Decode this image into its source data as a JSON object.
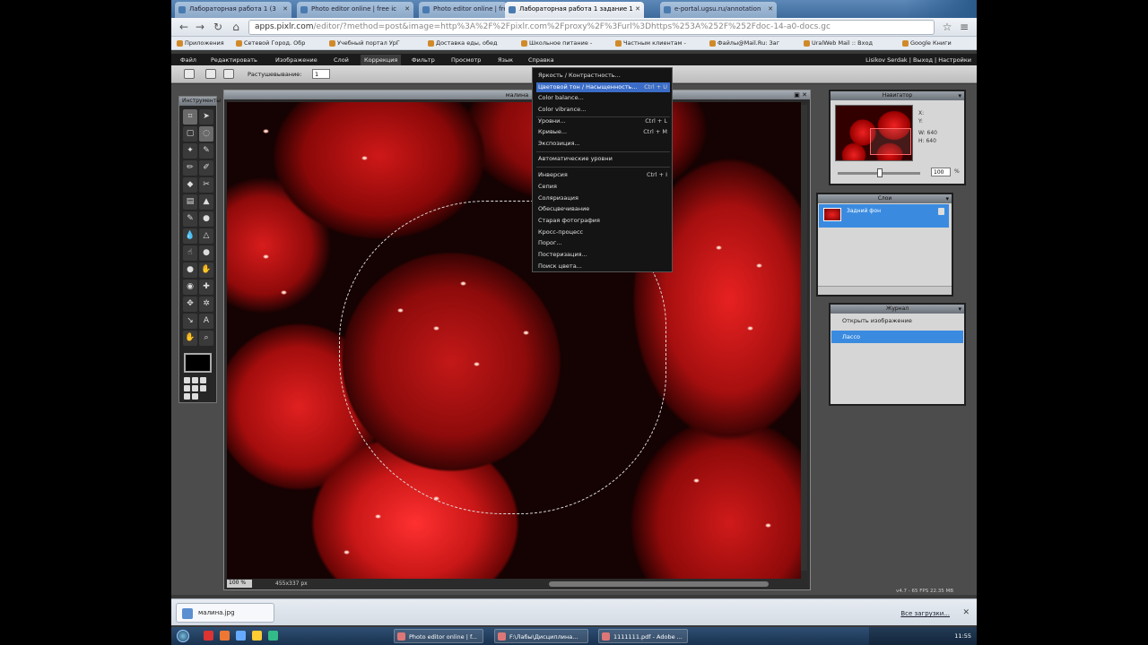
{
  "browser": {
    "tabs": [
      {
        "label": "Лабораторная работа 1 (3"
      },
      {
        "label": "Photo editor online | free ic"
      },
      {
        "label": "Photo editor online | free ic"
      },
      {
        "label": "Лабораторная работа 1 задание 1"
      },
      {
        "label": "e-portal.ugsu.ru/annotation"
      }
    ],
    "url_host": "apps.pixlr.com",
    "url_rest": "/editor/?method=post&image=http%3A%2F%2Fpixlr.com%2Fproxy%2F%3Furl%3Dhttps%253A%252F%252Fdoc-14-a0-docs.gc",
    "bookmarks": [
      "Приложения",
      "Сетевой Город. Обр",
      "Учебный портал УрГ",
      "Доставка еды, обед",
      "Школьное питание -",
      "Частным клиентам -",
      "Файлы@Mail.Ru: Заг",
      "UralWeb Mail :: Вход",
      "Google Книги"
    ]
  },
  "pixlr": {
    "menu": [
      "Файл",
      "Редактировать",
      "Изображение",
      "Слой",
      "Коррекция",
      "Фильтр",
      "Просмотр",
      "Язык",
      "Справка"
    ],
    "open_menu": "Коррекция",
    "user": "Lisikov Serdak",
    "logout": "Выход",
    "settings": "Настройки",
    "feather_label": "Растушевывание:",
    "feather_value": "1",
    "tools_title": "Инструменты",
    "doc_title": "малина",
    "zoom_value": "100",
    "zoom_unit": "%",
    "doc_size": "455x337 px",
    "adjust_menu": [
      {
        "label": "Яркость / Контрастность...",
        "shortcut": ""
      },
      {
        "label": "Цветовой тон / Насыщенность...",
        "shortcut": "Ctrl + U"
      },
      {
        "label": "Color balance...",
        "shortcut": ""
      },
      {
        "label": "Color vibrance...",
        "shortcut": ""
      },
      {
        "label": "Уровни...",
        "shortcut": "Ctrl + L"
      },
      {
        "label": "Кривые...",
        "shortcut": "Ctrl + M"
      },
      {
        "label": "Экспозиция...",
        "shortcut": ""
      },
      {
        "label": "Автоматические уровни",
        "shortcut": ""
      },
      {
        "label": "Инверсия",
        "shortcut": "Ctrl + I"
      },
      {
        "label": "Сепия",
        "shortcut": ""
      },
      {
        "label": "Соляризация",
        "shortcut": ""
      },
      {
        "label": "Обесцвечивание",
        "shortcut": ""
      },
      {
        "label": "Старая фотография",
        "shortcut": ""
      },
      {
        "label": "Кросс-процесс",
        "shortcut": ""
      },
      {
        "label": "Порог...",
        "shortcut": ""
      },
      {
        "label": "Постеризация...",
        "shortcut": ""
      },
      {
        "label": "Поиск цвета...",
        "shortcut": ""
      }
    ],
    "navigator": {
      "title": "Навигатор",
      "x_label": "X:",
      "y_label": "Y:",
      "w_label": "W:",
      "h_label": "H:",
      "w": "640",
      "h": "640",
      "zoom": "100",
      "zoom_unit": "%"
    },
    "layers": {
      "title": "Слои",
      "layer_name": "Задний фон"
    },
    "history": {
      "title": "Журнал",
      "items": [
        "Открыть изображение",
        "Лассо"
      ]
    },
    "version": "v4.7 - 65 FPS 22.35 MB"
  },
  "downloads": {
    "file": "малина.jpg",
    "all": "Все загрузки..."
  },
  "taskbar": {
    "tasks": [
      "Photo editor online | f...",
      "F:\\Лабы\\Дисциплина...",
      "1111111.pdf - Adobe ..."
    ],
    "clock": "11:55"
  }
}
